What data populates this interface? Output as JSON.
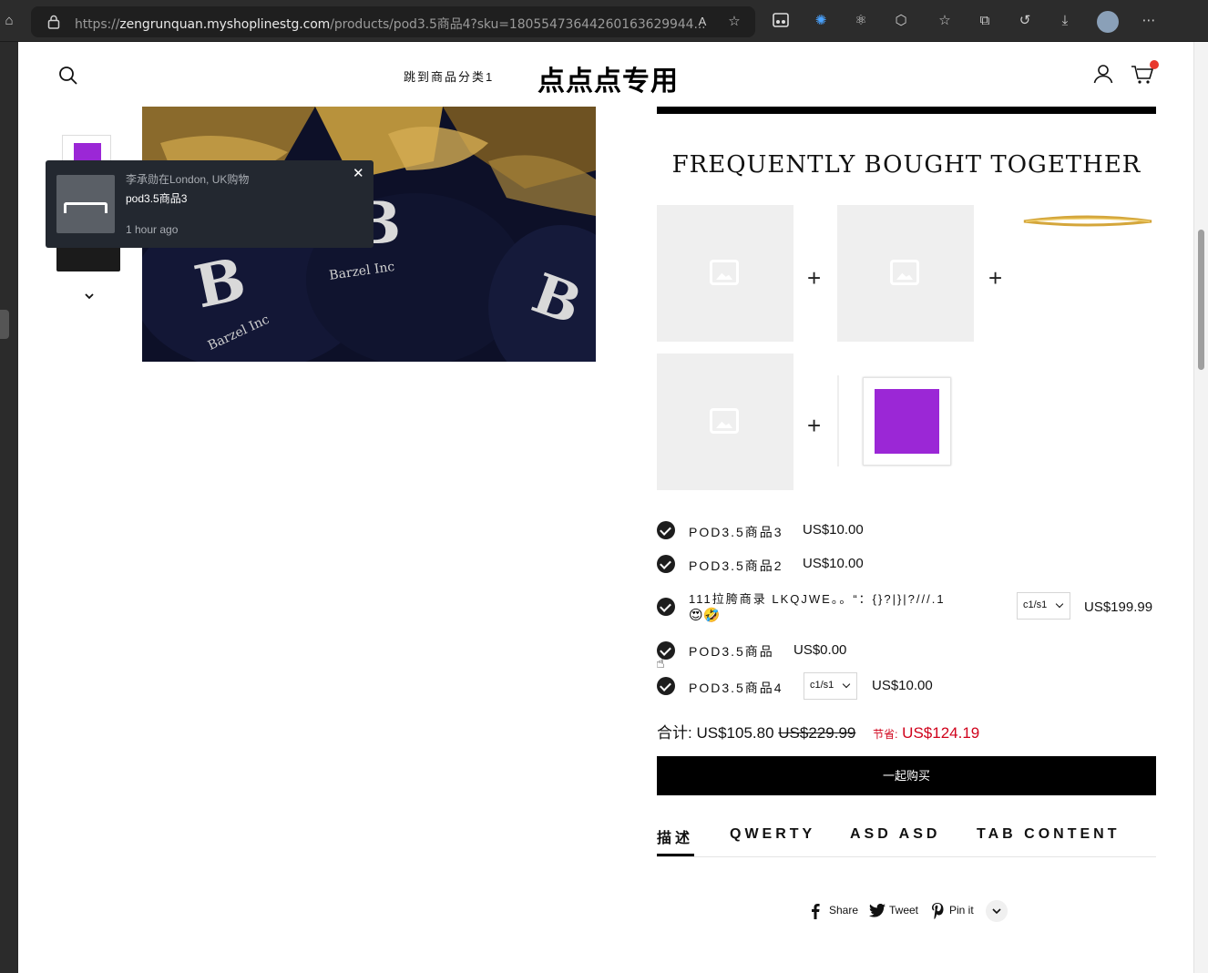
{
  "browser": {
    "url_prefix": "https://",
    "url_host": "zengrunquan.myshoplinestg.com",
    "url_path": "/products/pod3.5商品4?sku=18055473644260163629944..."
  },
  "header": {
    "nav_link": "跳到商品分类1",
    "brand": "点点点专用"
  },
  "toast": {
    "title": "李承勋在London, UK购物",
    "product": "pod3.5商品3",
    "time": "1 hour ago",
    "close": "✕"
  },
  "section_title": "FREQUENTLY BOUGHT TOGETHER",
  "plus_sign": "+",
  "bundle_items": [
    {
      "name": "POD3.5商品3",
      "price": "US$10.00"
    },
    {
      "name": "POD3.5商品2",
      "price": "US$10.00"
    },
    {
      "name_line1": "111拉胯商录 LKQJWE。。“：{}?|}|?///.1",
      "name_line2": "😍🤣",
      "variant": "c1/s1",
      "price": "US$199.99"
    },
    {
      "name": "POD3.5商品",
      "price": "US$0.00"
    },
    {
      "name": "POD3.5商品4",
      "variant": "c1/s1",
      "price": "US$10.00"
    }
  ],
  "totals": {
    "label": "合计:",
    "total": "US$105.80",
    "original": "US$229.99",
    "save_label": "节省:",
    "save": "US$124.19"
  },
  "buy_button": "一起购买",
  "tabs": [
    "描述",
    "QWERTY",
    "ASD ASD",
    "TAB CONTENT"
  ],
  "share": {
    "facebook": "Share",
    "twitter": "Tweet",
    "pinterest": "Pin it"
  },
  "colors": {
    "accent_purple": "#9b27d6",
    "save_red": "#d0021b",
    "cart_badge": "#e8382d"
  }
}
